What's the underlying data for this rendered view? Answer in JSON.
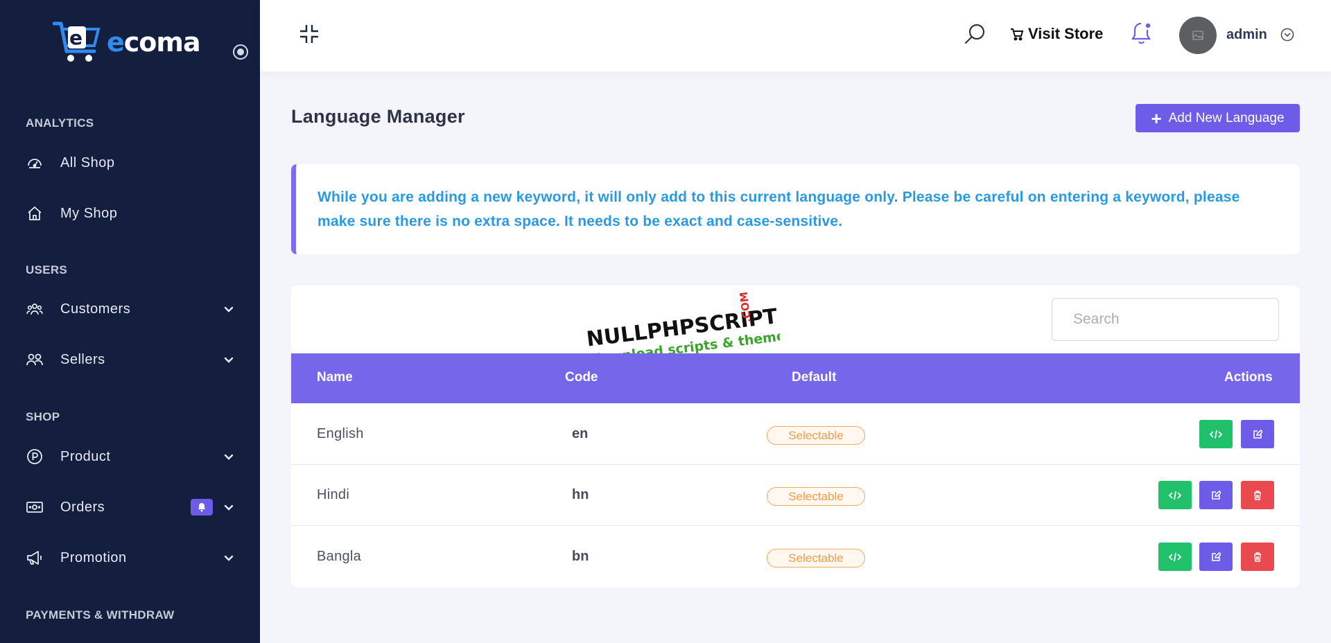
{
  "sidebar": {
    "logo_text_accent": "e",
    "logo_text_rest": "coma",
    "sections": [
      {
        "title": "ANALYTICS"
      },
      {
        "title": "USERS"
      },
      {
        "title": "SHOP"
      },
      {
        "title": "PAYMENTS & WITHDRAW"
      }
    ],
    "items": [
      {
        "label": "All Shop",
        "icon": "dashboard-icon"
      },
      {
        "label": "My Shop",
        "icon": "home-icon"
      },
      {
        "label": "Customers",
        "icon": "customers-icon",
        "expandable": true
      },
      {
        "label": "Sellers",
        "icon": "sellers-icon",
        "expandable": true
      },
      {
        "label": "Product",
        "icon": "product-icon",
        "expandable": true
      },
      {
        "label": "Orders",
        "icon": "orders-icon",
        "expandable": true,
        "badge_icon": "bell-icon"
      },
      {
        "label": "Promotion",
        "icon": "megaphone-icon",
        "expandable": true
      }
    ]
  },
  "header": {
    "visit_store": "Visit Store",
    "user_name": "admin"
  },
  "page": {
    "title": "Language Manager",
    "add_button": "Add New Language",
    "alert_text": "While you are adding a new keyword, it will only add to this current language only. Please be careful on entering a keyword, please make sure there is no extra space. It needs to be exact and case-sensitive."
  },
  "watermark": {
    "line1": "NULLPHPSCRIPT",
    "line1_suffix": ".COM",
    "line2": "download scripts & themes"
  },
  "table": {
    "search_placeholder": "Search",
    "columns": [
      "Name",
      "Code",
      "Default",
      "Actions"
    ],
    "rows": [
      {
        "name": "English",
        "code": "en",
        "default": "Selectable",
        "actions": [
          "code",
          "edit"
        ]
      },
      {
        "name": "Hindi",
        "code": "hn",
        "default": "Selectable",
        "actions": [
          "code",
          "edit",
          "delete"
        ]
      },
      {
        "name": "Bangla",
        "code": "bn",
        "default": "Selectable",
        "actions": [
          "code",
          "edit",
          "delete"
        ]
      }
    ]
  },
  "colors": {
    "sidebar_bg": "#141e3e",
    "accent": "#6c5ce7",
    "table_header": "#7566ea",
    "alert_text": "#2a9ae0",
    "success": "#21c06b",
    "danger": "#e84a4f",
    "badge_orange": "#f39b45"
  }
}
